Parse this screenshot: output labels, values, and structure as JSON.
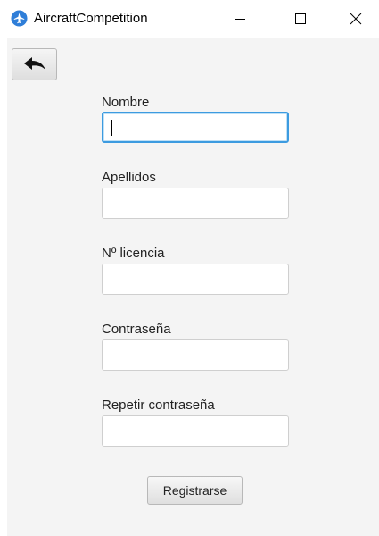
{
  "window": {
    "title": "AircraftCompetition",
    "app_icon": "airplane-icon",
    "controls": {
      "minimize_icon": "minimize-icon",
      "maximize_icon": "maximize-icon",
      "close_icon": "close-icon"
    }
  },
  "toolbar": {
    "back_icon": "back-arrow-icon"
  },
  "form": {
    "fields": [
      {
        "label": "Nombre",
        "value": "",
        "focused": true
      },
      {
        "label": "Apellidos",
        "value": ""
      },
      {
        "label": "Nº licencia",
        "value": ""
      },
      {
        "label": "Contraseña",
        "value": ""
      },
      {
        "label": "Repetir contraseña",
        "value": ""
      }
    ],
    "submit_label": "Registrarse"
  },
  "colors": {
    "accent": "#3c9be0",
    "app_icon": "#2f7ed8",
    "content_bg": "#f4f4f4"
  }
}
